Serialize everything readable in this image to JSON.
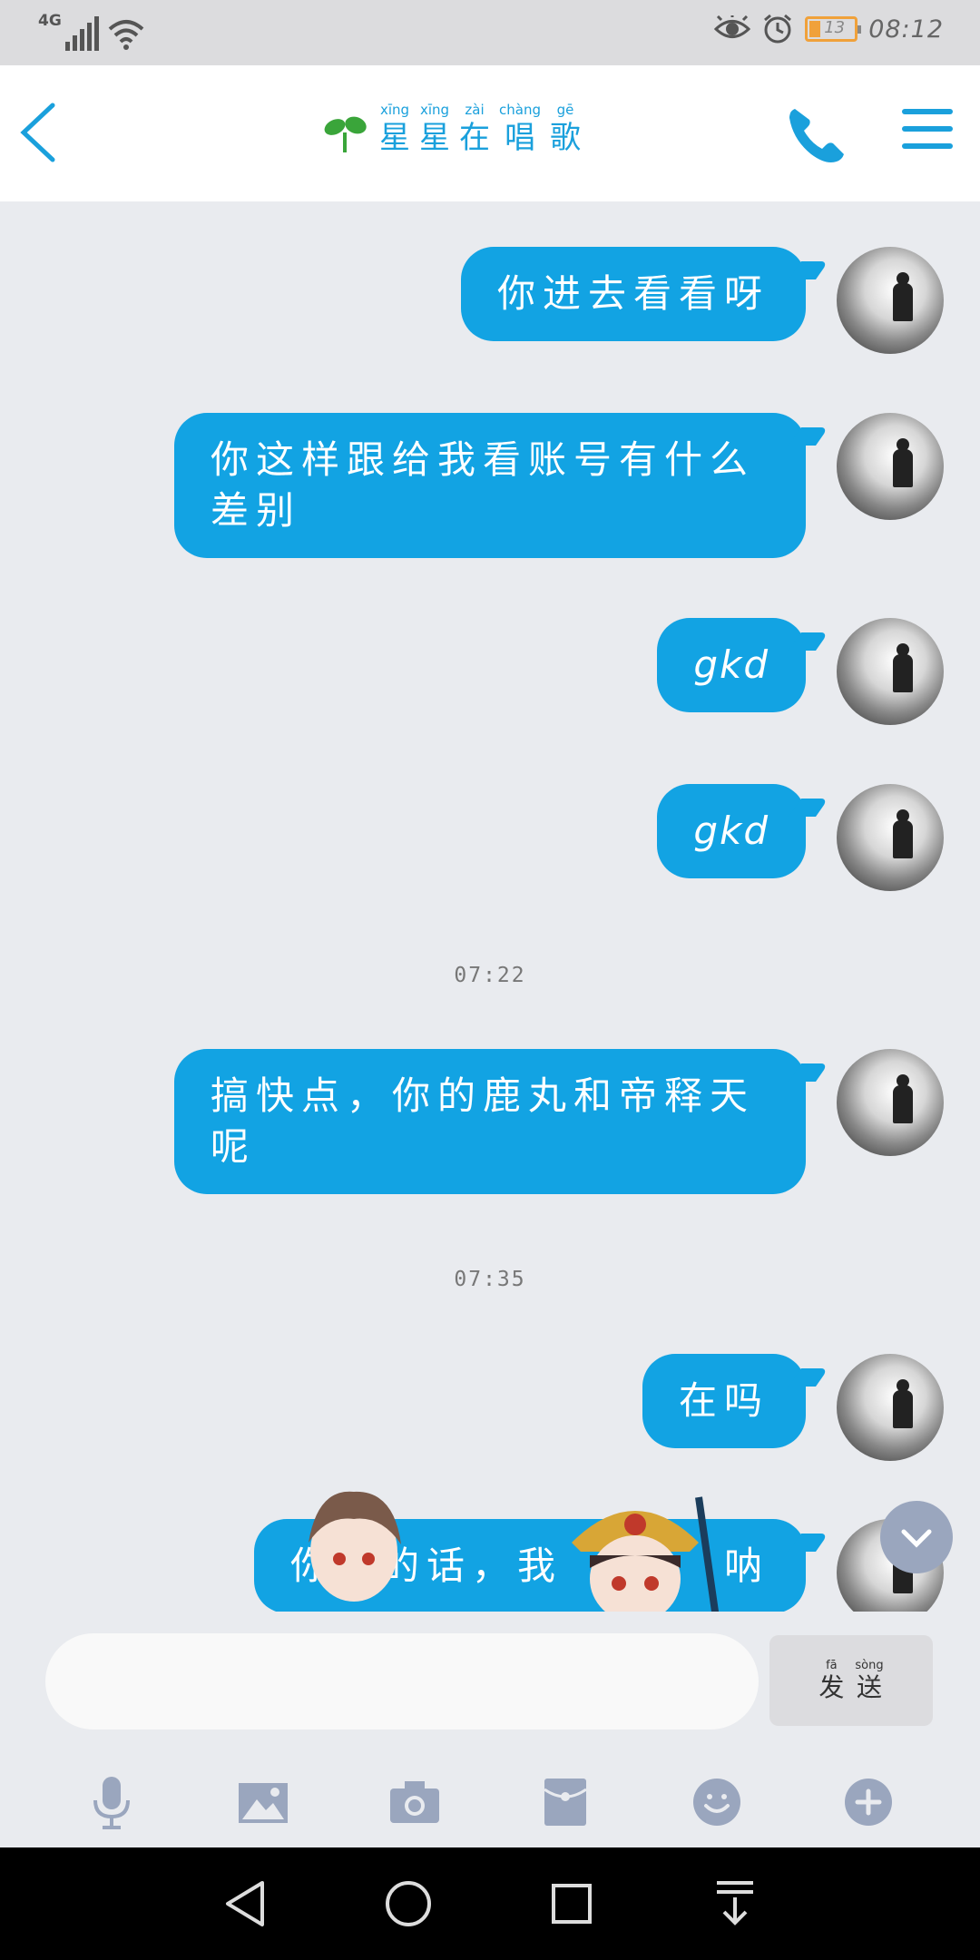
{
  "status_bar": {
    "network": "4G",
    "battery": "13",
    "time": "08:12"
  },
  "header": {
    "title_chars": [
      {
        "pinyin": "xīng",
        "hanzi": "星"
      },
      {
        "pinyin": "xīng",
        "hanzi": "星"
      },
      {
        "pinyin": "zài",
        "hanzi": "在"
      },
      {
        "pinyin": "chàng",
        "hanzi": "唱"
      },
      {
        "pinyin": "gē",
        "hanzi": "歌"
      }
    ],
    "icons": [
      "back-icon",
      "sprout-icon",
      "phone-icon",
      "menu-icon"
    ]
  },
  "messages": [
    {
      "text": "你进去看看呀"
    },
    {
      "text": "你这样跟给我看账号有什么差别"
    },
    {
      "text": "gkd"
    },
    {
      "text": "gkd"
    },
    {
      "text": "搞快点，你的鹿丸和帝释天呢"
    },
    {
      "text": "在吗"
    },
    {
      "text": "你不的话，我"
    }
  ],
  "timestamps": [
    "07:22",
    "07:35"
  ],
  "message_text_line2": {
    "msg1": "差别",
    "msg4": "呢"
  },
  "message_text_line1": {
    "msg1": "你这样跟给我看账号有什么",
    "msg4": "搞快点，你的鹿丸和帝释天",
    "msg6_tail": "呐"
  },
  "input": {
    "value": "",
    "send": [
      {
        "pinyin": "fā",
        "hanzi": "发"
      },
      {
        "pinyin": "sòng",
        "hanzi": "送"
      }
    ]
  },
  "toolbar_icons": [
    "microphone-icon",
    "image-icon",
    "camera-icon",
    "red-packet-icon",
    "emoji-icon",
    "plus-icon"
  ],
  "nav_icons": [
    "back-triangle-icon",
    "home-circle-icon",
    "recents-square-icon",
    "notification-pull-icon"
  ],
  "colors": {
    "accent": "#12a3e3",
    "background": "#e9ebef"
  }
}
